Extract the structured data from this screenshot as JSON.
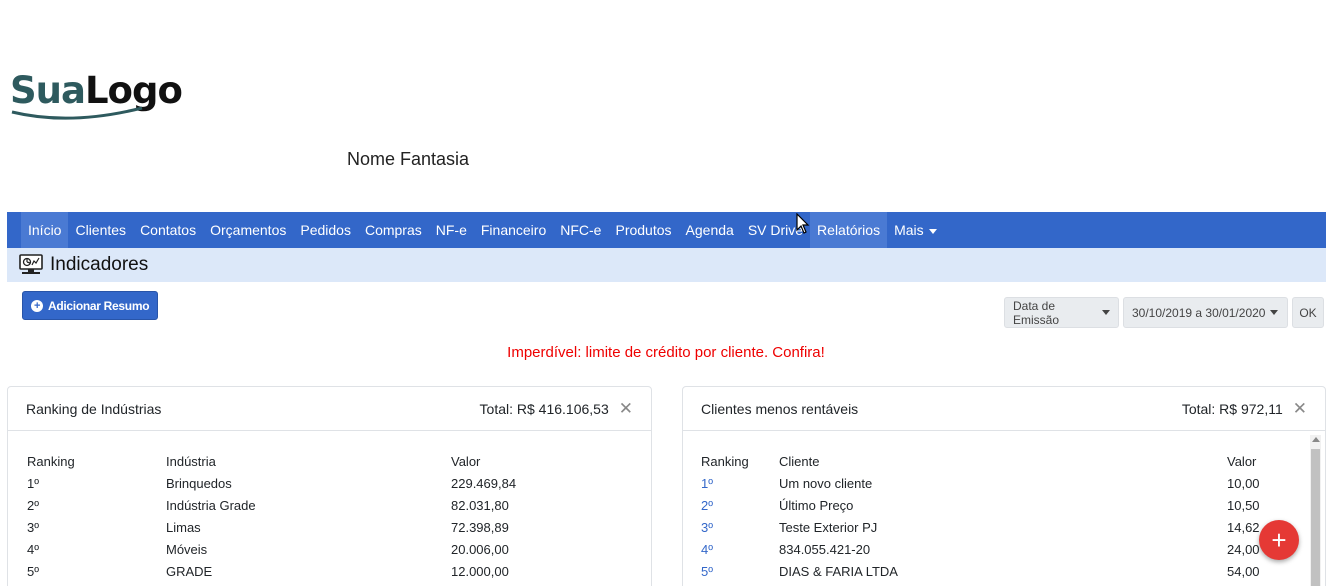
{
  "logo": {
    "part1": "Sua",
    "part2": "Logo"
  },
  "company": {
    "fantasy_name": "Nome Fantasia"
  },
  "nav": {
    "items": [
      {
        "label": "Início"
      },
      {
        "label": "Clientes"
      },
      {
        "label": "Contatos"
      },
      {
        "label": "Orçamentos"
      },
      {
        "label": "Pedidos"
      },
      {
        "label": "Compras"
      },
      {
        "label": "NF-e"
      },
      {
        "label": "Financeiro"
      },
      {
        "label": "NFC-e"
      },
      {
        "label": "Produtos"
      },
      {
        "label": "Agenda"
      },
      {
        "label": "SV Drive"
      },
      {
        "label": "Relatórios"
      },
      {
        "label": "Mais"
      }
    ]
  },
  "page": {
    "title": "Indicadores"
  },
  "toolbar": {
    "add_summary_label": "Adicionar Resumo",
    "date_type": "Data de Emissão",
    "date_range": "30/10/2019 a 30/01/2020",
    "ok_label": "OK"
  },
  "promo": {
    "text": "Imperdível: limite de crédito por cliente. Confira!"
  },
  "cards": {
    "industries": {
      "title": "Ranking de Indústrias",
      "total": "Total: R$ 416.106,53",
      "headers": {
        "rank": "Ranking",
        "name": "Indústria",
        "value": "Valor"
      },
      "rows": [
        {
          "rank": "1º",
          "name": "Brinquedos",
          "value": "229.469,84"
        },
        {
          "rank": "2º",
          "name": "Indústria Grade",
          "value": "82.031,80"
        },
        {
          "rank": "3º",
          "name": "Limas",
          "value": "72.398,89"
        },
        {
          "rank": "4º",
          "name": "Móveis",
          "value": "20.006,00"
        },
        {
          "rank": "5º",
          "name": "GRADE",
          "value": "12.000,00"
        }
      ]
    },
    "clients": {
      "title": "Clientes menos rentáveis",
      "total": "Total: R$ 972,11",
      "headers": {
        "rank": "Ranking",
        "name": "Cliente",
        "value": "Valor"
      },
      "rows": [
        {
          "rank": "1º",
          "name": "Um novo cliente",
          "value": "10,00"
        },
        {
          "rank": "2º",
          "name": "Último Preço",
          "value": "10,50"
        },
        {
          "rank": "3º",
          "name": "Teste Exterior PJ",
          "value": "14,62"
        },
        {
          "rank": "4º",
          "name": "834.055.421-20",
          "value": "24,00"
        },
        {
          "rank": "5º",
          "name": "DIAS & FARIA LTDA",
          "value": "54,00"
        }
      ]
    }
  },
  "colors": {
    "primary": "#3367c9",
    "subheader": "#dce8f9",
    "alert": "#e00000",
    "fab": "#e53935"
  },
  "icons": {
    "indicators": "monitor-chart-icon",
    "add": "plus-circle-icon",
    "close": "close-icon",
    "fab": "plus-icon"
  }
}
